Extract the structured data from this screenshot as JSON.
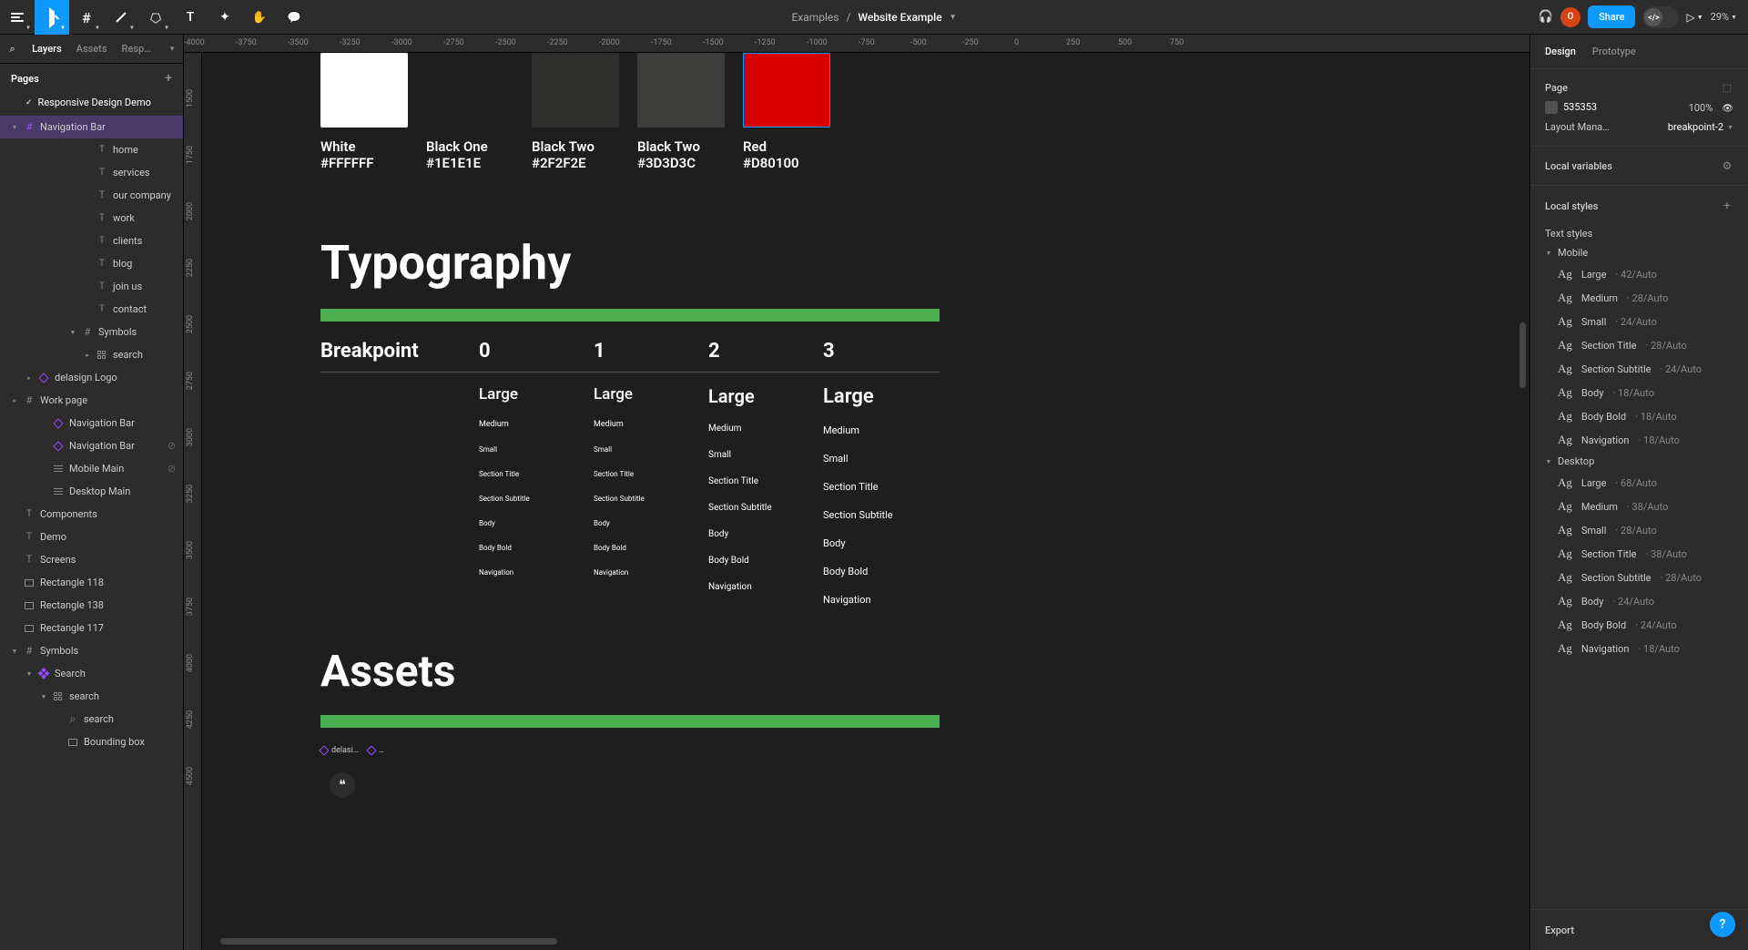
{
  "toolbar": {
    "breadcrumb_parent": "Examples",
    "breadcrumb_current": "Website Example",
    "avatar_letter": "O",
    "share_label": "Share",
    "zoom": "29%"
  },
  "left": {
    "tabs": [
      "Layers",
      "Assets",
      "Respon…"
    ],
    "pages_label": "Pages",
    "page_name": "Responsive Design Demo",
    "layers": [
      {
        "ind": 0,
        "tw": "▼",
        "icon": "frame",
        "comp": true,
        "name": "Navigation Bar",
        "sel": true
      },
      {
        "ind": 5,
        "icon": "text",
        "name": "home"
      },
      {
        "ind": 5,
        "icon": "text",
        "name": "services"
      },
      {
        "ind": 5,
        "icon": "text",
        "name": "our company"
      },
      {
        "ind": 5,
        "icon": "text",
        "name": "work"
      },
      {
        "ind": 5,
        "icon": "text",
        "name": "clients"
      },
      {
        "ind": 5,
        "icon": "text",
        "name": "blog"
      },
      {
        "ind": 5,
        "icon": "text",
        "name": "join us"
      },
      {
        "ind": 5,
        "icon": "text",
        "name": "contact"
      },
      {
        "ind": 4,
        "tw": "▼",
        "icon": "frame",
        "name": "Symbols"
      },
      {
        "ind": 5,
        "tw": "▸",
        "icon": "grid",
        "name": "search"
      },
      {
        "ind": 1,
        "tw": "▸",
        "icon": "diamond",
        "comp": true,
        "name": "delasign Logo"
      },
      {
        "ind": 0,
        "tw": "▸",
        "icon": "frame",
        "name": "Work page"
      },
      {
        "ind": 2,
        "icon": "diamond",
        "comp": true,
        "name": "Navigation Bar"
      },
      {
        "ind": 2,
        "icon": "diamond",
        "comp": true,
        "name": "Navigation Bar",
        "vis": true
      },
      {
        "ind": 2,
        "icon": "lines",
        "name": "Mobile Main",
        "vis": true
      },
      {
        "ind": 2,
        "icon": "lines",
        "name": "Desktop Main"
      },
      {
        "ind": 0,
        "icon": "text",
        "name": "Components"
      },
      {
        "ind": 0,
        "icon": "text",
        "name": "Demo"
      },
      {
        "ind": 0,
        "icon": "text",
        "name": "Screens"
      },
      {
        "ind": 0,
        "icon": "rect",
        "name": "Rectangle 118"
      },
      {
        "ind": 0,
        "icon": "rect",
        "name": "Rectangle 138"
      },
      {
        "ind": 0,
        "icon": "rect",
        "name": "Rectangle 117"
      },
      {
        "ind": 0,
        "tw": "▼",
        "icon": "frame",
        "name": "Symbols"
      },
      {
        "ind": 1,
        "tw": "▼",
        "icon": "diamond4",
        "comp": true,
        "name": "Search"
      },
      {
        "ind": 2,
        "tw": "▼",
        "icon": "grid",
        "name": "search"
      },
      {
        "ind": 3,
        "icon": "search",
        "name": "search"
      },
      {
        "ind": 3,
        "icon": "rect",
        "name": "Bounding box"
      }
    ]
  },
  "canvas": {
    "h_ticks": [
      "-4000",
      "-3750",
      "-3500",
      "-3250",
      "-3000",
      "-2750",
      "-2500",
      "-2250",
      "-2000",
      "-1750",
      "-1500",
      "-1250",
      "-1000",
      "-750",
      "-500",
      "-250",
      "0",
      "250",
      "500",
      "750"
    ],
    "v_ticks": [
      "1500",
      "1750",
      "2000",
      "2250",
      "2500",
      "2750",
      "3000",
      "3250",
      "3500",
      "3750",
      "4000",
      "4250",
      "4500"
    ],
    "swatches": [
      {
        "name": "White",
        "hex": "#FFFFFF",
        "color": "#FFFFFF"
      },
      {
        "name": "Black One",
        "hex": "#1E1E1E",
        "color": "#1E1E1E"
      },
      {
        "name": "Black Two",
        "hex": "#2F2F2E",
        "color": "#2F2F2E"
      },
      {
        "name": "Black Two",
        "hex": "#3D3D3C",
        "color": "#3D3D3C"
      },
      {
        "name": "Red",
        "hex": "#D80100",
        "color": "#D80100"
      }
    ],
    "typo_title": "Typography",
    "bp_label": "Breakpoint",
    "bp_cols": [
      "0",
      "1",
      "2",
      "3"
    ],
    "type_rows": [
      "Large",
      "Medium",
      "Small",
      "Section Title",
      "Section Subtitle",
      "Body",
      "Body Bold",
      "Navigation"
    ],
    "assets_title": "Assets",
    "asset_tags": [
      "delasi…",
      "…"
    ],
    "circle_glyph": "❝"
  },
  "right": {
    "tabs": [
      "Design",
      "Prototype"
    ],
    "page_label": "Page",
    "page_color": "535353",
    "page_pct": "100%",
    "layout_label": "Layout Mana…",
    "layout_val": "breakpoint-2",
    "local_vars": "Local variables",
    "local_styles": "Local styles",
    "text_styles_label": "Text styles",
    "export_label": "Export",
    "groups": [
      {
        "name": "Mobile",
        "items": [
          {
            "n": "Large",
            "m": "42/Auto"
          },
          {
            "n": "Medium",
            "m": "28/Auto"
          },
          {
            "n": "Small",
            "m": "24/Auto"
          },
          {
            "n": "Section Title",
            "m": "28/Auto"
          },
          {
            "n": "Section Subtitle",
            "m": "24/Auto"
          },
          {
            "n": "Body",
            "m": "18/Auto"
          },
          {
            "n": "Body Bold",
            "m": "18/Auto"
          },
          {
            "n": "Navigation",
            "m": "18/Auto"
          }
        ]
      },
      {
        "name": "Desktop",
        "items": [
          {
            "n": "Large",
            "m": "68/Auto"
          },
          {
            "n": "Medium",
            "m": "38/Auto"
          },
          {
            "n": "Small",
            "m": "28/Auto"
          },
          {
            "n": "Section Title",
            "m": "38/Auto"
          },
          {
            "n": "Section Subtitle",
            "m": "28/Auto"
          },
          {
            "n": "Body",
            "m": "24/Auto"
          },
          {
            "n": "Body Bold",
            "m": "24/Auto"
          },
          {
            "n": "Navigation",
            "m": "18/Auto"
          }
        ]
      }
    ]
  }
}
